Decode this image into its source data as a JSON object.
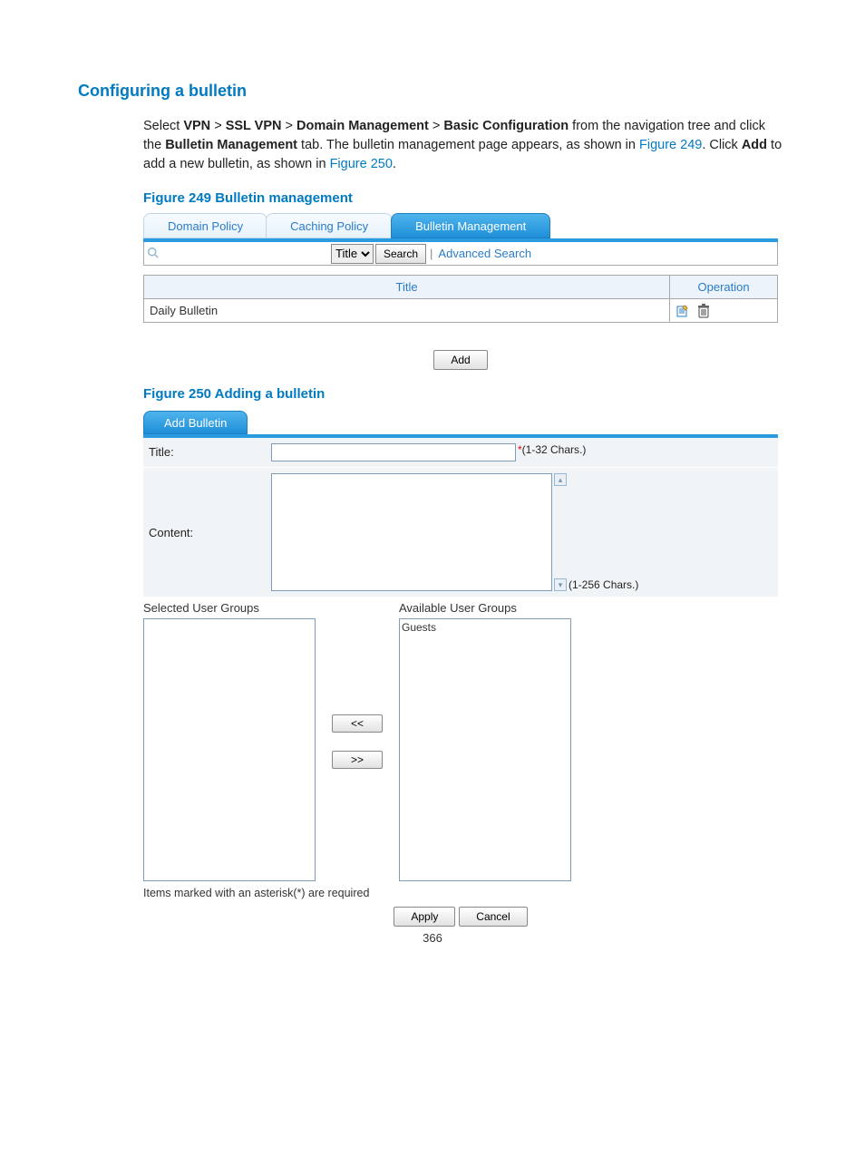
{
  "heading": "Configuring a bulletin",
  "intro": {
    "part1": "Select ",
    "nav1": "VPN",
    "sep": " > ",
    "nav2": "SSL VPN",
    "nav3": "Domain Management",
    "nav4": "Basic Configuration",
    "part2": " from the navigation tree and click the ",
    "tabname": "Bulletin Management",
    "part3": " tab. The bulletin management page appears, as shown in ",
    "fig249": "Figure 249",
    "part4": ". Click ",
    "addbold": "Add",
    "part5": " to add a new bulletin, as shown in ",
    "fig250": "Figure 250",
    "part6": "."
  },
  "fig249_caption": "Figure 249 Bulletin management",
  "fig249": {
    "tabs": [
      "Domain Policy",
      "Caching Policy",
      "Bulletin Management"
    ],
    "active_tab": 2,
    "search_select": "Title",
    "search_button": "Search",
    "advanced": "Advanced Search",
    "table": {
      "headers": [
        "Title",
        "Operation"
      ],
      "rows": [
        {
          "title": "Daily Bulletin"
        }
      ]
    },
    "add_button": "Add"
  },
  "fig250_caption": "Figure 250 Adding a bulletin",
  "fig250": {
    "tab": "Add Bulletin",
    "title_label": "Title:",
    "title_hint": "(1-32 Chars.)",
    "content_label": "Content:",
    "content_hint": "(1-256 Chars.)",
    "selected_label": "Selected User Groups",
    "available_label": "Available User Groups",
    "available_items": [
      "Guests"
    ],
    "move_left": "<<",
    "move_right": ">>",
    "required_note": "Items marked with an asterisk(*) are required",
    "apply": "Apply",
    "cancel": "Cancel"
  },
  "page_number": "366"
}
